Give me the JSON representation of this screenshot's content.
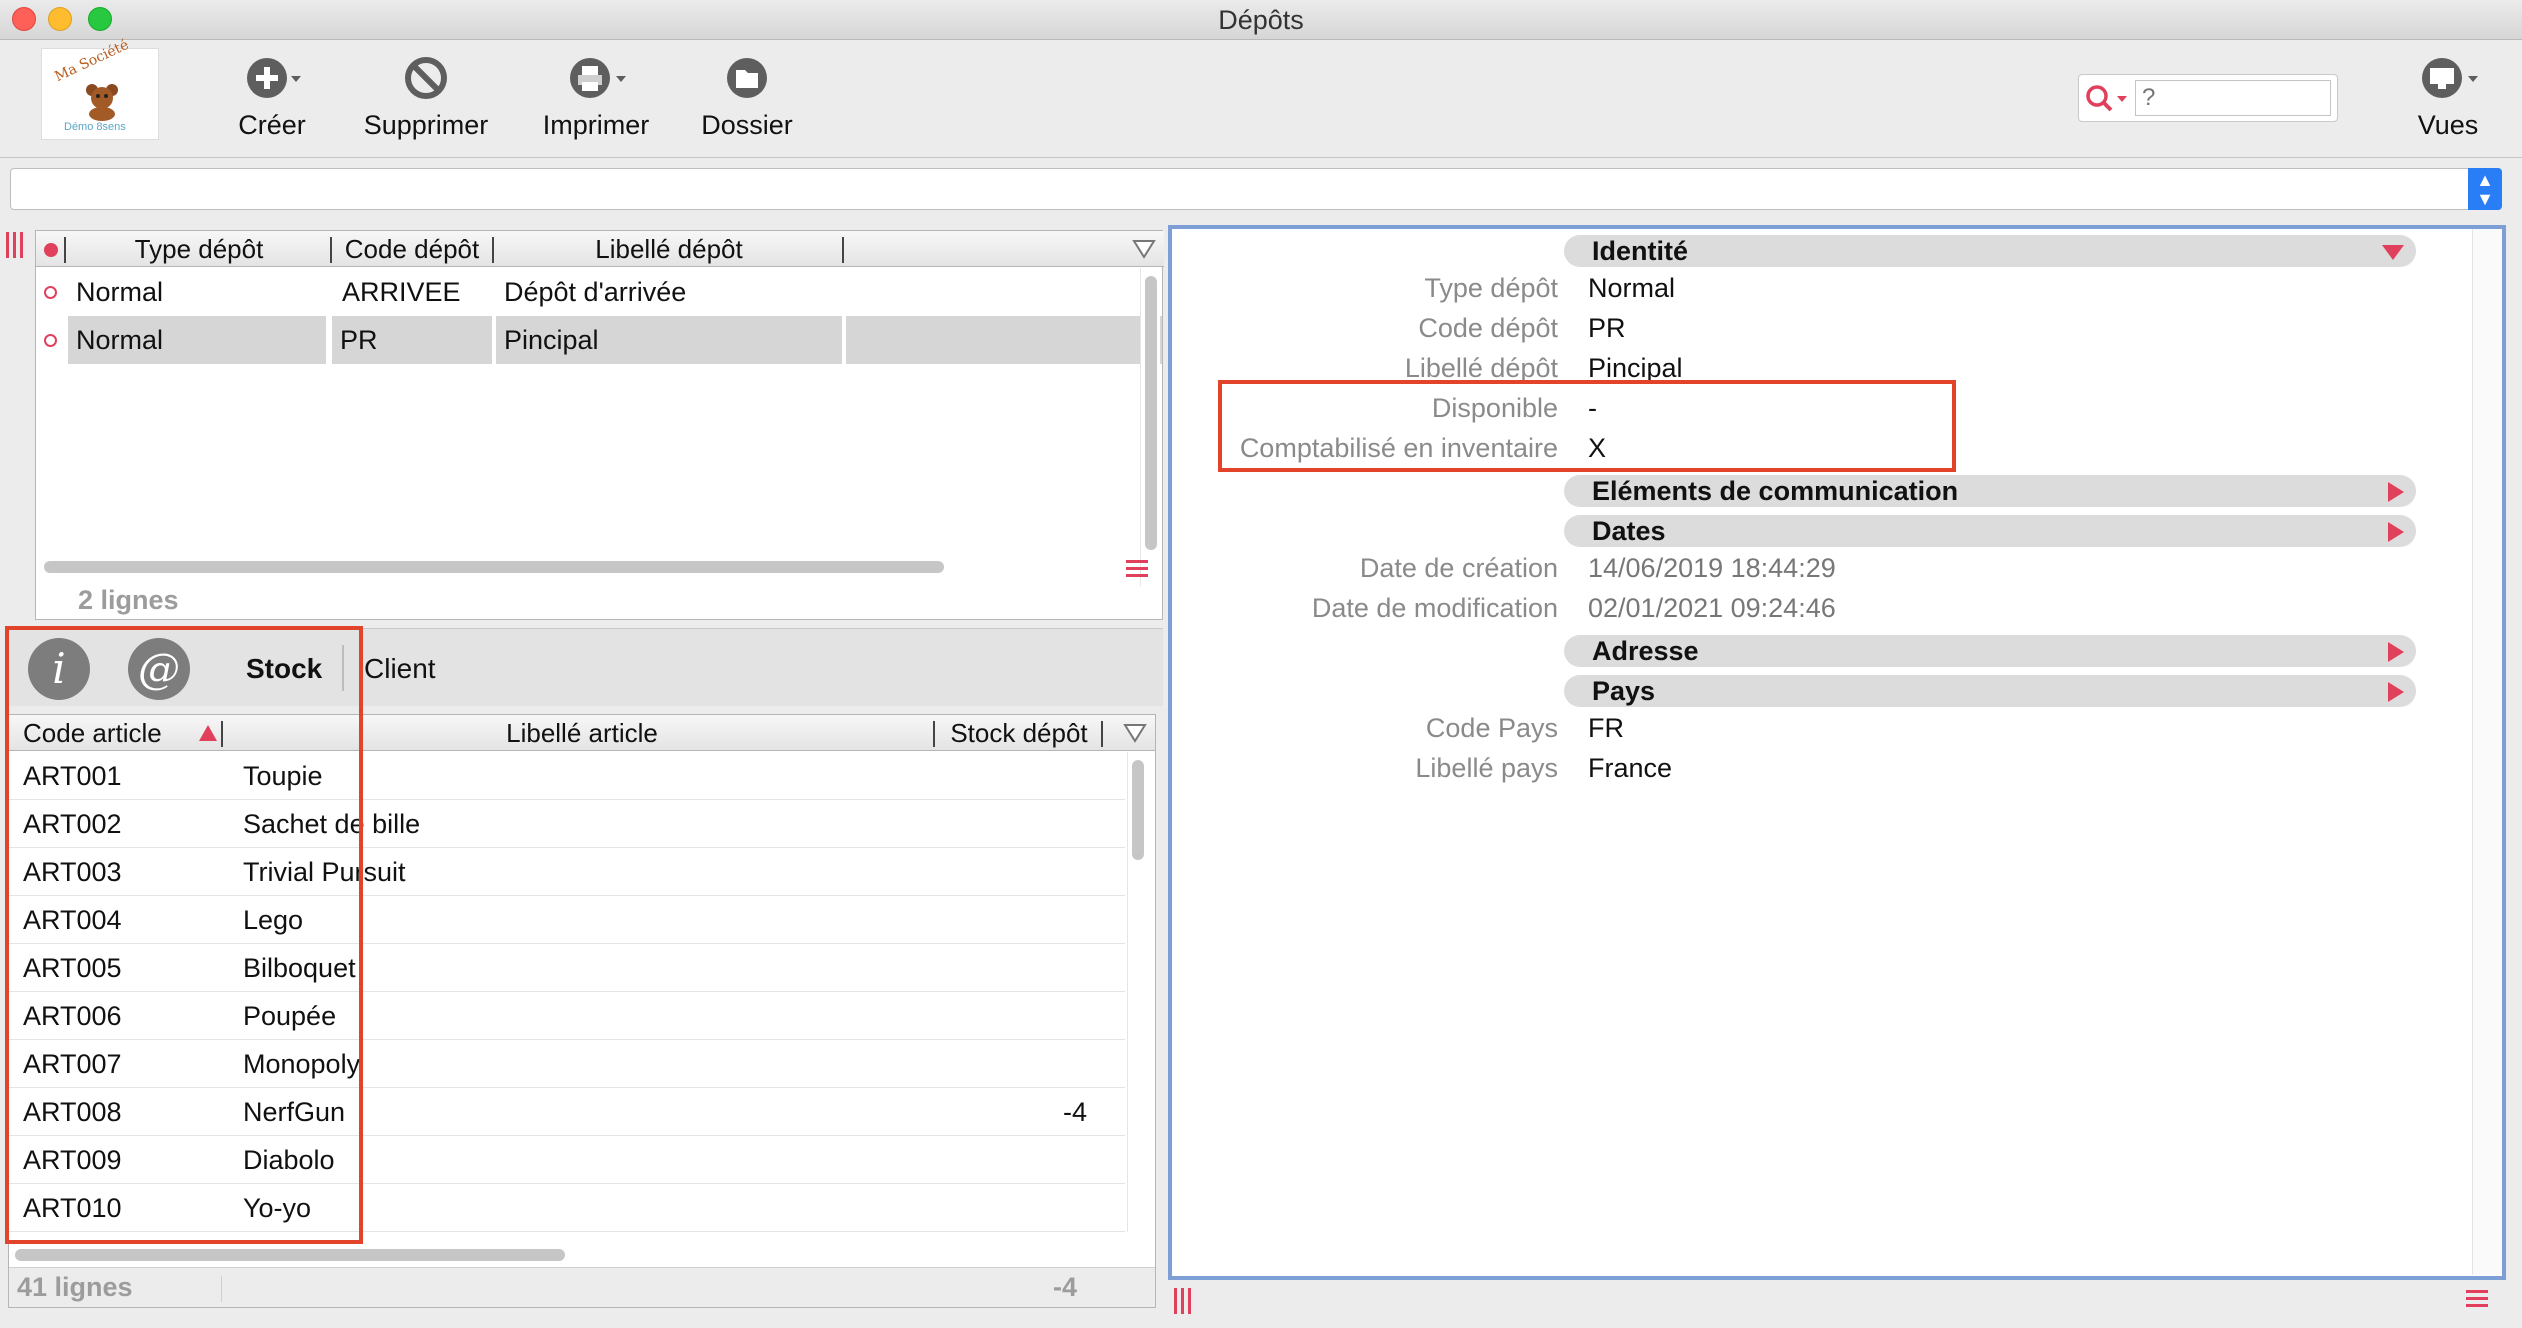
{
  "window": {
    "title": "Dépôts"
  },
  "toolbar": {
    "logo_text": "Ma Société",
    "logo_sub": "Démo 8sens",
    "create_label": "Créer",
    "delete_label": "Supprimer",
    "print_label": "Imprimer",
    "folder_label": "Dossier",
    "views_label": "Vues",
    "search_placeholder": "?"
  },
  "depots_list": {
    "columns": [
      "Type dépôt",
      "Code dépôt",
      "Libellé dépôt"
    ],
    "rows": [
      {
        "type": "Normal",
        "code": "ARRIVEE",
        "label": "Dépôt d'arrivée"
      },
      {
        "type": "Normal",
        "code": "PR",
        "label": "Pincipal"
      }
    ],
    "count": "2 lignes"
  },
  "tabs": {
    "stock": "Stock",
    "client": "Client",
    "info_icon": "i",
    "at_icon": "@"
  },
  "articles_list": {
    "columns": [
      "Code article",
      "Libellé article",
      "Stock dépôt"
    ],
    "rows": [
      {
        "code": "ART001",
        "label": "Toupie",
        "stock": ""
      },
      {
        "code": "ART002",
        "label": "Sachet de bille",
        "stock": ""
      },
      {
        "code": "ART003",
        "label": "Trivial Pursuit",
        "stock": ""
      },
      {
        "code": "ART004",
        "label": "Lego",
        "stock": ""
      },
      {
        "code": "ART005",
        "label": "Bilboquet",
        "stock": ""
      },
      {
        "code": "ART006",
        "label": "Poupée",
        "stock": ""
      },
      {
        "code": "ART007",
        "label": "Monopoly",
        "stock": ""
      },
      {
        "code": "ART008",
        "label": "NerfGun",
        "stock": "-4"
      },
      {
        "code": "ART009",
        "label": "Diabolo",
        "stock": ""
      },
      {
        "code": "ART010",
        "label": "Yo-yo",
        "stock": ""
      }
    ],
    "count": "41 lignes",
    "total": "-4"
  },
  "detail": {
    "identite": {
      "title": "Identité",
      "type_label": "Type dépôt",
      "type_value": "Normal",
      "code_label": "Code dépôt",
      "code_value": "PR",
      "libelle_label": "Libellé dépôt",
      "libelle_value": "Pincipal",
      "dispo_label": "Disponible",
      "dispo_value": "-",
      "compta_label": "Comptabilisé en inventaire",
      "compta_value": "X"
    },
    "communication": {
      "title": "Eléments de communication"
    },
    "dates": {
      "title": "Dates",
      "creation_label": "Date de création",
      "creation_value": "14/06/2019 18:44:29",
      "modif_label": "Date de modification",
      "modif_value": "02/01/2021 09:24:46"
    },
    "adresse": {
      "title": "Adresse"
    },
    "pays": {
      "title": "Pays",
      "code_label": "Code Pays",
      "code_value": "FR",
      "libelle_label": "Libellé pays",
      "libelle_value": "France"
    }
  },
  "colors": {
    "accent": "#e0405c",
    "annotation": "#e2442b",
    "panel_border": "#7e9fd6",
    "combo_blue": "#2a7ef5"
  }
}
